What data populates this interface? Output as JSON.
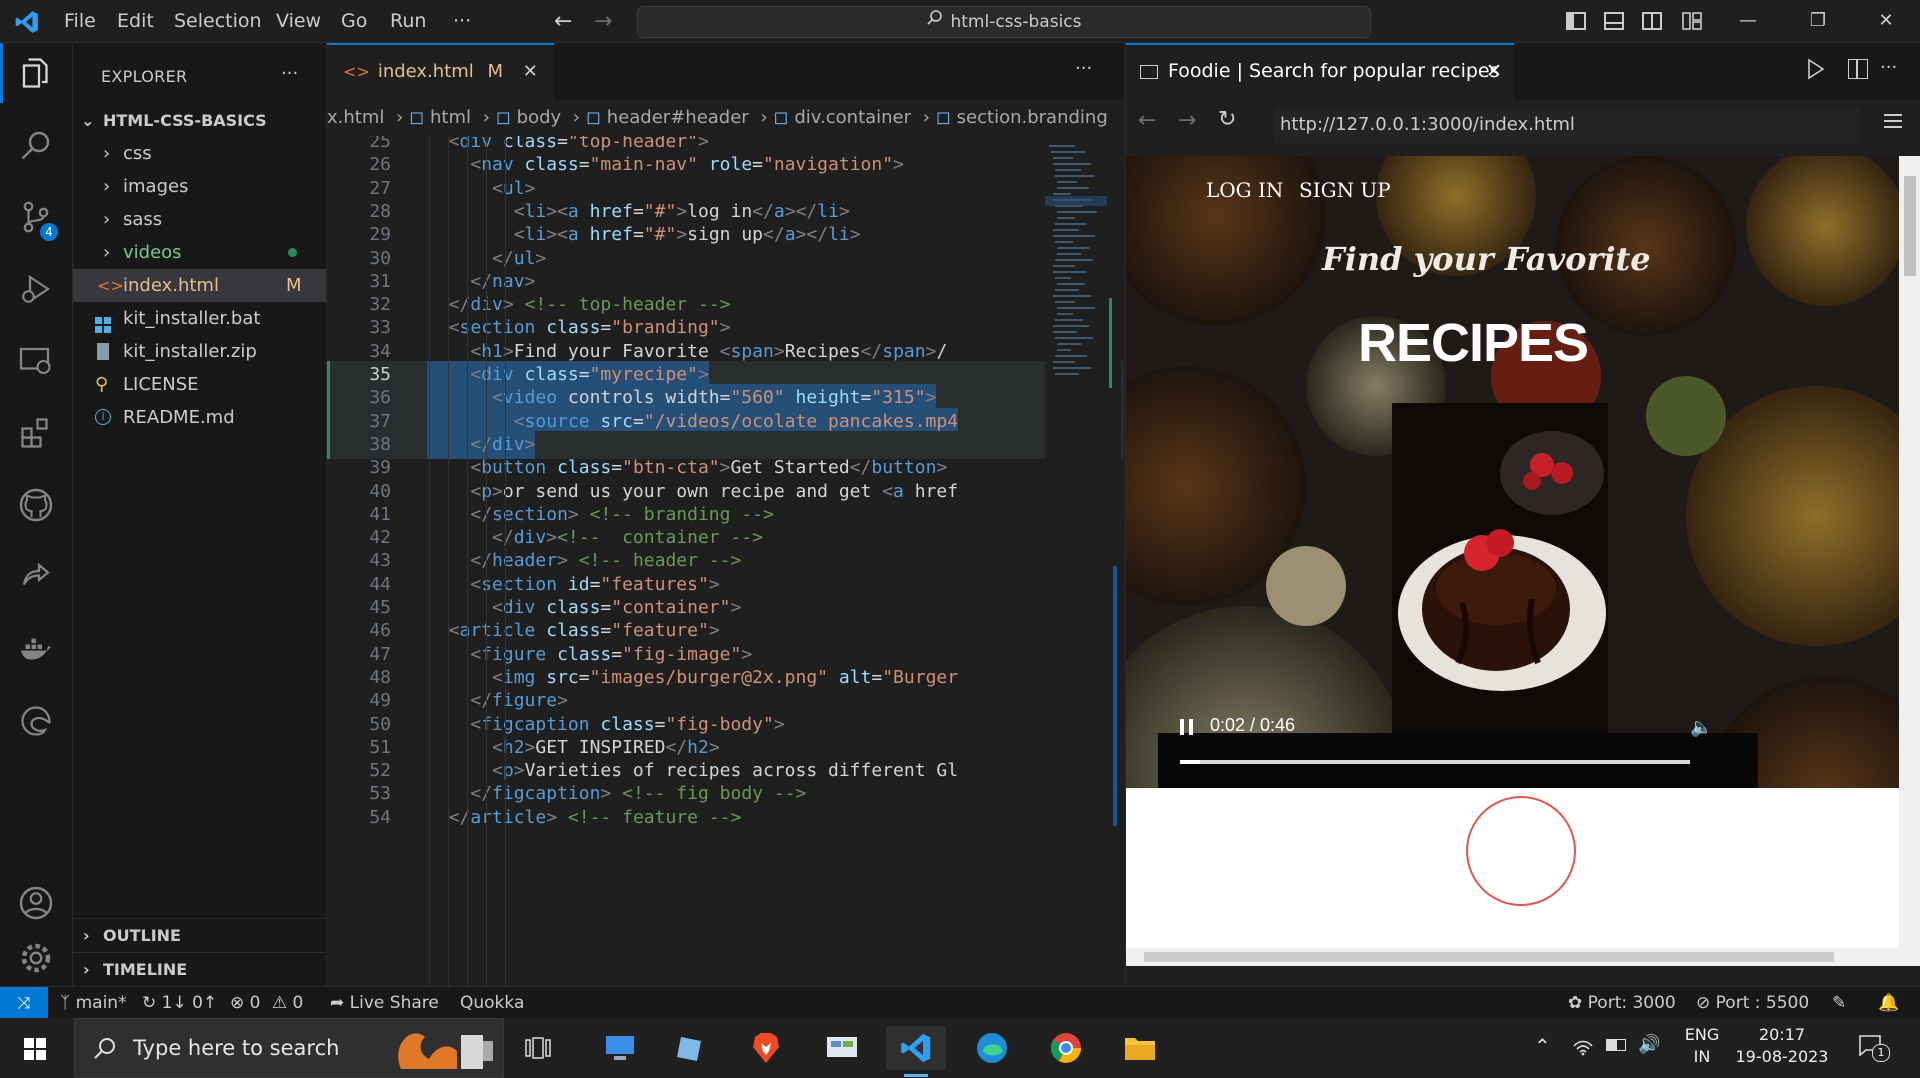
{
  "titlebar": {
    "menu": [
      "File",
      "Edit",
      "Selection",
      "View",
      "Go",
      "Run",
      "···"
    ],
    "command_center": "html-css-basics"
  },
  "activity": {
    "scm_badge": "4"
  },
  "sidebar": {
    "title": "EXPLORER",
    "more": "···",
    "root": "HTML-CSS-BASICS",
    "items": [
      {
        "label": "css",
        "type": "folder"
      },
      {
        "label": "images",
        "type": "folder"
      },
      {
        "label": "sass",
        "type": "folder"
      },
      {
        "label": "videos",
        "type": "folder"
      },
      {
        "label": "index.html",
        "type": "html",
        "badge": "M"
      },
      {
        "label": "kit_installer.bat",
        "type": "bat"
      },
      {
        "label": "kit_installer.zip",
        "type": "zip"
      },
      {
        "label": "LICENSE",
        "type": "license"
      },
      {
        "label": "README.md",
        "type": "md"
      }
    ],
    "outline": "OUTLINE",
    "timeline": "TIMELINE"
  },
  "editor": {
    "tab": {
      "label": "index.html",
      "badge": "M"
    },
    "more": "···",
    "breadcrumb": [
      "x.html",
      "html",
      "body",
      "header#header",
      "div.container",
      "section.branding"
    ],
    "lines": [
      {
        "n": "25",
        "t": "        <div class=\"top-header\">"
      },
      {
        "n": "26",
        "t": "          <nav class=\"main-nav\" role=\"navigation\">"
      },
      {
        "n": "27",
        "t": "            <ul>"
      },
      {
        "n": "28",
        "t": "              <li><a href=\"#\">log in</a></li>"
      },
      {
        "n": "29",
        "t": "              <li><a href=\"#\">sign up</a></li>"
      },
      {
        "n": "30",
        "t": "            </ul>"
      },
      {
        "n": "31",
        "t": "          </nav>"
      },
      {
        "n": "32",
        "t": "        </div> <!-- top-header -->"
      },
      {
        "n": "33",
        "t": "        <section class=\"branding\">"
      },
      {
        "n": "34",
        "t": "          <h1>Find your Favorite <span>Recipes</span></"
      },
      {
        "n": "35",
        "t": "          <div class=\"myrecipe\">"
      },
      {
        "n": "36",
        "t": "            <video controls width=\"560\" height=\"315\">"
      },
      {
        "n": "37",
        "t": "              <source src=\"/videos/ocolate pancakes.mp4"
      },
      {
        "n": "38",
        "t": "          </div>"
      },
      {
        "n": "39",
        "t": "          <button class=\"btn-cta\">Get Started</button>"
      },
      {
        "n": "40",
        "t": "          <p>or send us your own recipe and get <a href"
      },
      {
        "n": "41",
        "t": "          </section> <!-- branding -->"
      },
      {
        "n": "42",
        "t": "      </div><!--  container -->"
      },
      {
        "n": "43",
        "t": "    </header> <!-- header -->"
      },
      {
        "n": "44",
        "t": "    <section id=\"features\">"
      },
      {
        "n": "45",
        "t": "      <div class=\"container\">"
      },
      {
        "n": "46",
        "t": "        <article class=\"feature\">"
      },
      {
        "n": "47",
        "t": "          <figure class=\"fig-image\">"
      },
      {
        "n": "48",
        "t": "            <img src=\"images/burger@2x.png\" alt=\"Burger"
      },
      {
        "n": "49",
        "t": "          </figure>"
      },
      {
        "n": "50",
        "t": "          <figcaption class=\"fig-body\">"
      },
      {
        "n": "51",
        "t": "            <h2>GET INSPIRED</h2>"
      },
      {
        "n": "52",
        "t": "            <p>Varieties of recipes across different Gl"
      },
      {
        "n": "53",
        "t": "          </figcaption> <!-- fig body -->"
      },
      {
        "n": "54",
        "t": "        </article> <!-- feature -->"
      }
    ]
  },
  "browser": {
    "tab_title": "Foodie | Search for popular recipes",
    "url": "http://127.0.0.1:3000/index.html",
    "page": {
      "nav": [
        "LOG IN",
        "SIGN UP"
      ],
      "heading_small": "Find your Favorite",
      "heading_big": "RECIPES",
      "video_time": "0:02 / 0:46",
      "video_progress": 0.04
    }
  },
  "status": {
    "branch": "main*",
    "sync": "1↓ 0↑",
    "errors": "0",
    "warnings": "0",
    "live_share": "Live Share",
    "quokka": "Quokka",
    "port1": "Port: 3000",
    "port2": "Port : 5500"
  },
  "taskbar": {
    "search_placeholder": "Type here to search",
    "lang_top": "ENG",
    "lang_bottom": "IN",
    "time": "20:17",
    "date": "19-08-2023",
    "notif_count": "1"
  },
  "colors": {
    "accent": "#0078d4",
    "modified": "#e2c08d",
    "added": "#73c991",
    "highlight": "#264f78"
  }
}
